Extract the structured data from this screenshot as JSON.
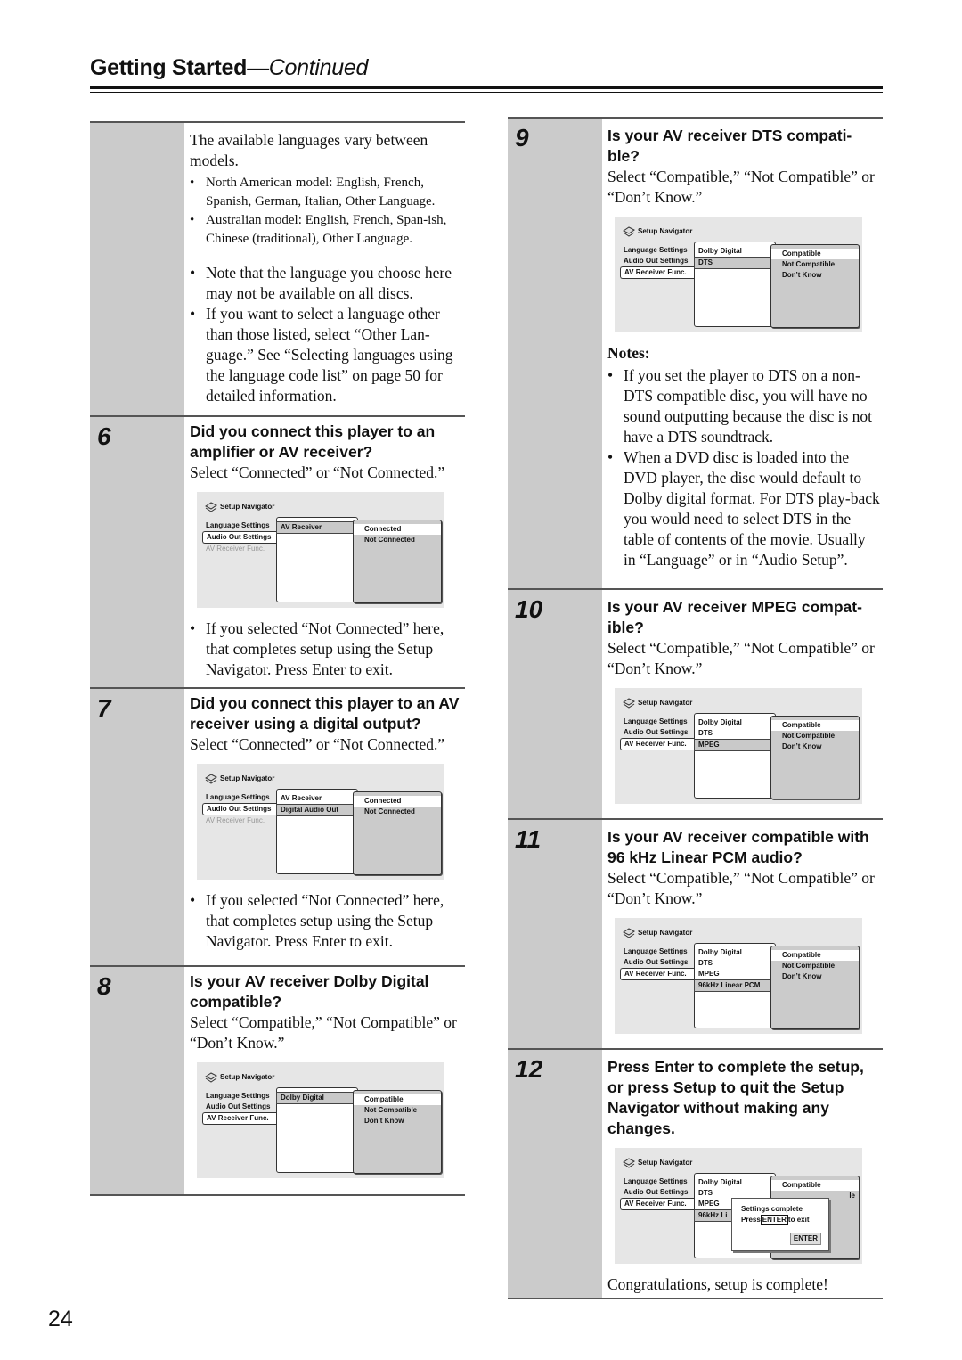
{
  "header": {
    "title": "Getting Started",
    "subtitle": "—Continued"
  },
  "page_number": "24",
  "intro": {
    "text": "The available languages vary between models.",
    "model_bullets": [
      "North American model: English, French, Spanish, German, Italian, Other Language.",
      "Australian model: English, French, Span-ish, Chinese (traditional), Other Language."
    ],
    "bullets": [
      "Note that the language you choose here may not be available on all discs.",
      "If you want to select a language other than those listed, select “Other Lan-guage.” See “Selecting languages using the language code list” on page 50 for detailed information."
    ]
  },
  "osd_common": {
    "title": "Setup Navigator",
    "left_menu": [
      "Language Settings",
      "Audio Out Settings",
      "AV Receiver Func."
    ]
  },
  "steps": [
    {
      "number": "6",
      "question": "Did you connect this player to an amplifier or AV receiver?",
      "instruction": "Select “Connected” or “Not Connected.”",
      "osd": {
        "mid": [
          "AV Receiver"
        ],
        "options": [
          "Connected",
          "Not Connected"
        ]
      },
      "after": "If you selected “Not Connected” here, that completes setup using the Setup Navigator. Press Enter to exit."
    },
    {
      "number": "7",
      "question": "Did you connect this player to an AV receiver using a digital output?",
      "instruction": "Select “Connected” or “Not Connected.”",
      "osd": {
        "mid": [
          "AV Receiver",
          "Digital Audio Out"
        ],
        "options": [
          "Connected",
          "Not Connected"
        ]
      },
      "after": "If you selected “Not Connected” here, that completes setup using the Setup Navigator. Press Enter to exit."
    },
    {
      "number": "8",
      "question": "Is your AV receiver Dolby Digital compatible?",
      "instruction": "Select “Compatible,” “Not Compatible” or “Don’t Know.”",
      "osd": {
        "mid": [
          "Dolby Digital"
        ],
        "options": [
          "Compatible",
          "Not Compatible",
          "Don’t Know"
        ]
      }
    },
    {
      "number": "9",
      "question": "Is your AV receiver DTS compati-ble?",
      "instruction": "Select “Compatible,” “Not Compatible” or “Don’t Know.”",
      "osd": {
        "mid": [
          "Dolby Digital",
          "DTS"
        ],
        "options": [
          "Compatible",
          "Not Compatible",
          "Don’t Know"
        ]
      },
      "notes_title": "Notes:",
      "notes": [
        "If you set the player to DTS on a non-DTS compatible disc, you will have no sound outputting because the disc is not have a DTS soundtrack.",
        "When a DVD disc is loaded into the DVD player, the disc would default to Dolby digital format. For DTS play-back you would need to select DTS in the table of contents of the movie. Usually in “Language” or in “Audio Setup”."
      ]
    },
    {
      "number": "10",
      "question": "Is your AV receiver MPEG compat-ible?",
      "instruction": "Select “Compatible,” “Not Compatible” or “Don’t Know.”",
      "osd": {
        "mid": [
          "Dolby Digital",
          "DTS",
          "MPEG"
        ],
        "options": [
          "Compatible",
          "Not Compatible",
          "Don’t Know"
        ]
      }
    },
    {
      "number": "11",
      "question": "Is your AV receiver compatible with 96 kHz Linear PCM audio?",
      "instruction": "Select “Compatible,” “Not Compatible” or “Don’t Know.”",
      "osd": {
        "mid": [
          "Dolby Digital",
          "DTS",
          "MPEG",
          "96kHz Linear PCM"
        ],
        "options": [
          "Compatible",
          "Not Compatible",
          "Don’t Know"
        ]
      }
    },
    {
      "number": "12",
      "question": "Press Enter to complete the setup, or press Setup to quit the Setup Navigator without making any changes.",
      "osd": {
        "mid": [
          "Dolby Digital",
          "DTS",
          "MPEG",
          "96kHz Li"
        ],
        "options": [
          "Compatible",
          "le"
        ],
        "dialog": {
          "line1": "Settings complete",
          "press": "Press",
          "key": "ENTER",
          "to_exit": "to exit",
          "button": "ENTER"
        }
      },
      "after": "Congratulations, setup is complete!"
    }
  ]
}
